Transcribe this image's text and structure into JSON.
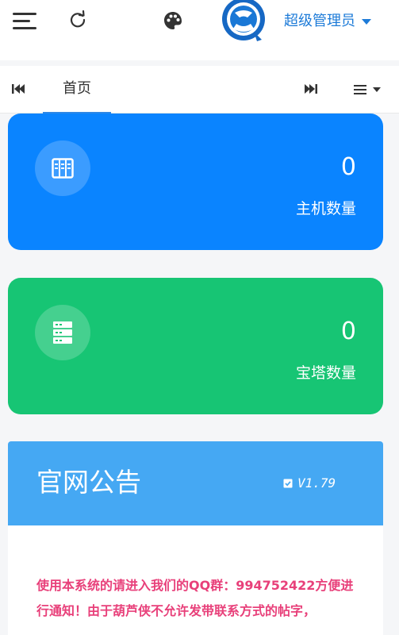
{
  "header": {
    "user_name": "超级管理员"
  },
  "tabs": {
    "home_label": "首页"
  },
  "stats": [
    {
      "label": "主机数量",
      "value": "0"
    },
    {
      "label": "宝塔数量",
      "value": "0"
    }
  ],
  "notice": {
    "title": "官网公告",
    "version": "V1.79",
    "body": "使用本系统的请进入我们的QQ群：994752422方便进行通知！由于葫芦侠不允许发带联系方式的帖字，"
  },
  "colors": {
    "hosts_card": "#0a84ff",
    "bt_card": "#17c574",
    "notice_header": "#45a8f3",
    "notice_text": "#e8407a",
    "accent": "#1d7bd8"
  }
}
